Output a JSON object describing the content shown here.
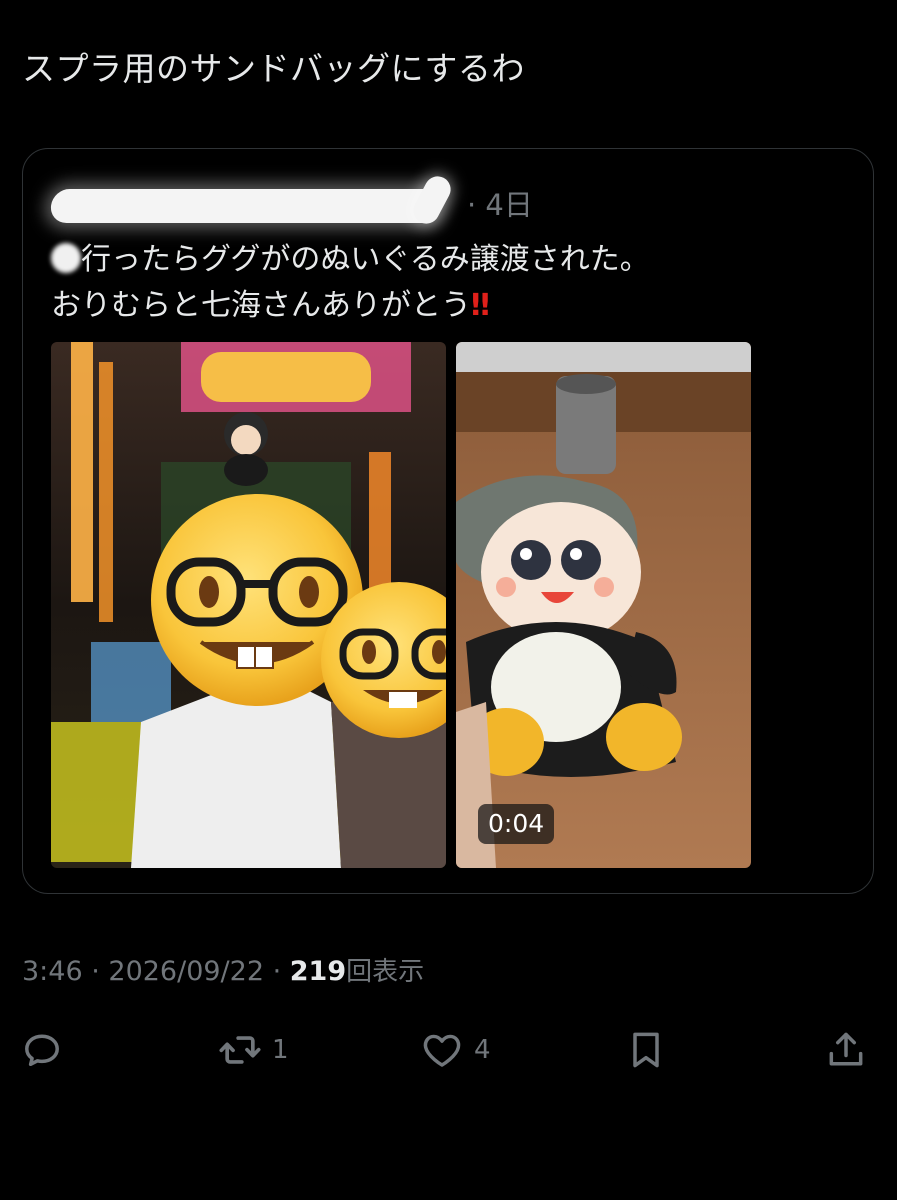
{
  "post": {
    "text": "スプラ用のサンドバッグにするわ"
  },
  "quote": {
    "time": "· 4日",
    "line1": "行ったらググがのぬいぐるみ譲渡された。",
    "line2": "おりむらと七海さんありがとう",
    "exclaim": "‼",
    "media": [
      {
        "type": "photo",
        "icon": "nerd-face-emoji"
      },
      {
        "type": "video",
        "duration": "0:04"
      }
    ]
  },
  "meta": {
    "time": "3:46",
    "separator1": " · ",
    "date": "2026/09/22",
    "separator2": " · ",
    "views": "219",
    "views_label": "回表示"
  },
  "actions": {
    "reply_icon": "reply-icon",
    "retweet_icon": "retweet-icon",
    "retweet_count": "1",
    "like_icon": "heart-icon",
    "like_count": "4",
    "bookmark_icon": "bookmark-icon",
    "share_icon": "share-icon"
  },
  "colors": {
    "background": "#000000",
    "text": "#e7e9ea",
    "muted": "#71767b",
    "border": "#2f3336",
    "exclaim": "#e0201a"
  }
}
